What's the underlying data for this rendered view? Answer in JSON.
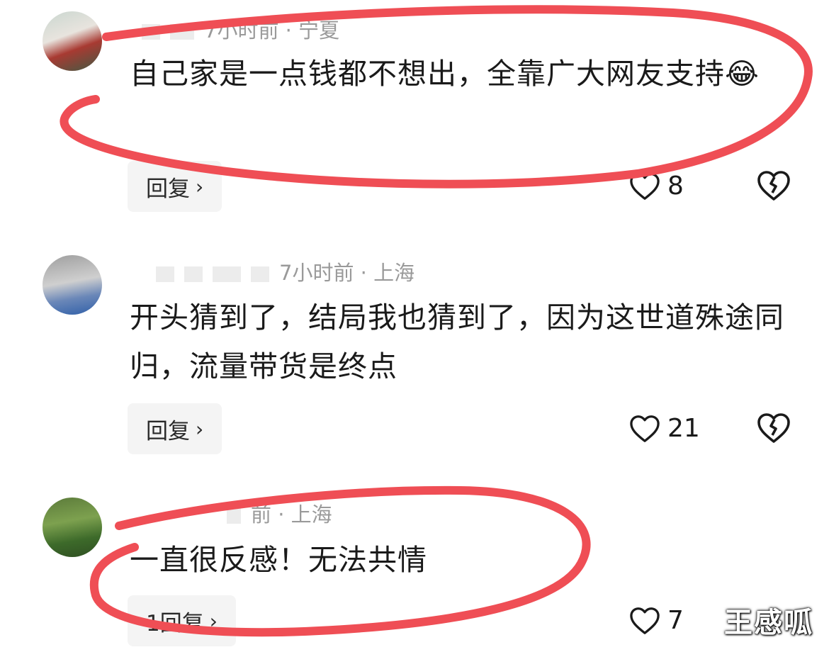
{
  "comments": [
    {
      "meta": "7小时前 · 宁夏",
      "text": "自己家是一点钱都不想出，全靠广大网友支持",
      "emoji": "😂",
      "reply_label": "回复",
      "likes": "8"
    },
    {
      "meta": "7小时前 · 上海",
      "text": "开头猜到了，结局我也猜到了，因为这世道殊途同归，流量带货是终点",
      "reply_label": "回复",
      "likes": "21"
    },
    {
      "meta": "前 · 上海",
      "text": "一直很反感！无法共情",
      "reply_label": "1回复",
      "likes": "7"
    }
  ],
  "icons": {
    "heart": "heart-outline-icon",
    "dislike": "broken-heart-icon",
    "chevron": "chevron-right-icon"
  },
  "annotation_color": "#ef4e55",
  "watermark": "王感呱"
}
